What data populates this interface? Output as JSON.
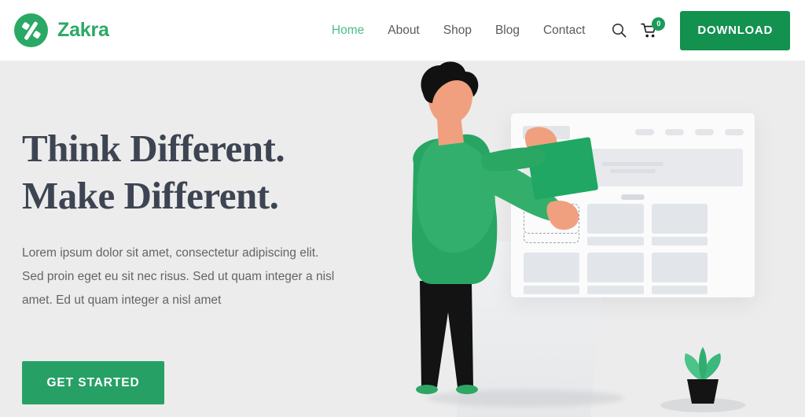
{
  "header": {
    "brand": {
      "name": "Zakra",
      "logo_icon": "zakra-circle-slash-logo",
      "color": "#2aa966"
    },
    "nav": [
      {
        "label": "Home",
        "active": true
      },
      {
        "label": "About",
        "active": false
      },
      {
        "label": "Shop",
        "active": false
      },
      {
        "label": "Blog",
        "active": false
      },
      {
        "label": "Contact",
        "active": false
      }
    ],
    "tools": {
      "search_icon": "search-icon",
      "cart_icon": "shopping-cart-icon",
      "cart_count": "0",
      "cart_badge_color": "#1a9b5c"
    },
    "download_label": "DOWNLOAD",
    "download_color": "#12914f",
    "background": "#ffffff"
  },
  "hero": {
    "title_line1": "Think Different.",
    "title_line2": "Make Different.",
    "title_color": "#3d4452",
    "paragraph": "Lorem ipsum dolor sit amet, consectetur adipiscing elit. Sed proin eget eu sit nec risus. Sed ut quam integer a nisl amet.  Ed ut quam integer a nisl amet",
    "cta_label": "GET STARTED",
    "cta_color": "#27a065",
    "background": "#ececec",
    "illustration": {
      "name": "person-building-website-illustration",
      "mock_window": "website-wireframe-mockup",
      "dropzone": "dashed-drop-placeholder",
      "plant": "potted-plant",
      "accent_green": "#27a065",
      "skin_tone": "#f0a07e",
      "hair_color": "#111111",
      "pants_color": "#131313"
    }
  }
}
